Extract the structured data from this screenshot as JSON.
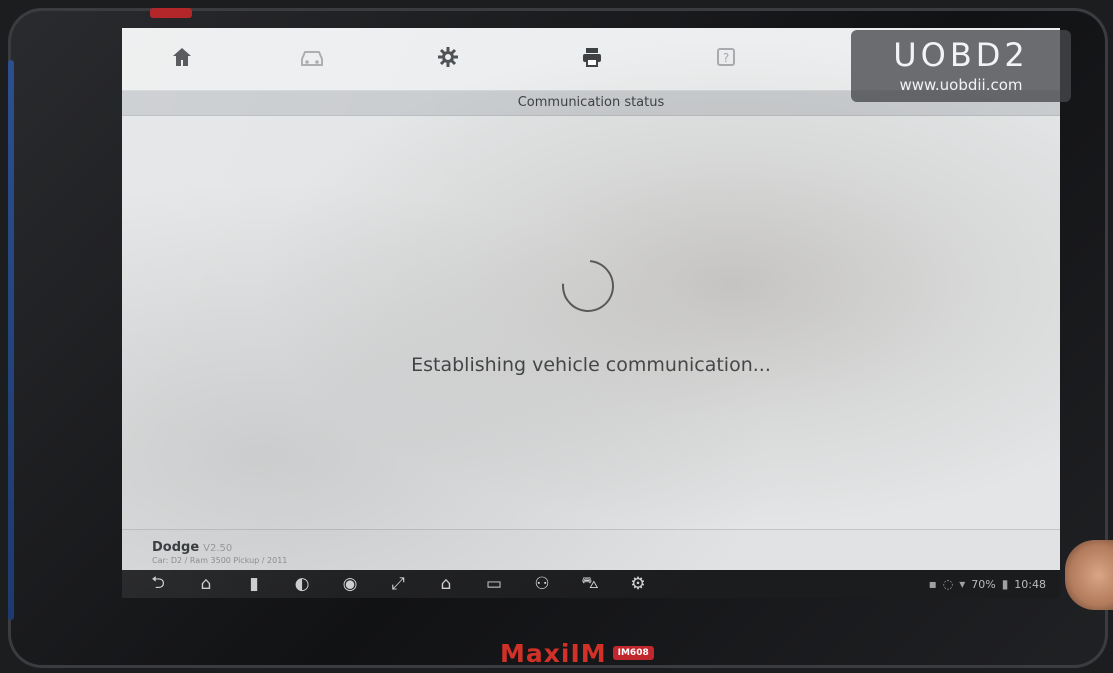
{
  "toolbar": {
    "icons": [
      "home-icon",
      "vehicle-swap-icon",
      "settings-gear-icon",
      "print-icon",
      "help-icon"
    ],
    "title": "Communication status"
  },
  "status": {
    "message": "Establishing vehicle communication..."
  },
  "vehicle": {
    "make": "Dodge",
    "version": "V2.50",
    "details": "Car: D2 / Ram 3500 Pickup / 2011"
  },
  "navbar": {
    "icons": [
      "back-icon",
      "home-icon",
      "recent-apps-icon",
      "chrome-icon",
      "camera-icon",
      "screen-scale-icon",
      "maxiim-home-icon",
      "vci-icon",
      "vehicle-connect-icon",
      "car-icon",
      "service-icon"
    ],
    "battery": "70%",
    "time": "10:48"
  },
  "watermark": {
    "main": "UOBD2",
    "sub": "www.uobdii.com"
  },
  "device": {
    "brand": "MaxiIM",
    "model": "IM608"
  },
  "colors": {
    "screen_bg": "#e3e5e6",
    "title_bar": "#c9cccf",
    "navbar": "#1b1c1e",
    "brand_red": "#d23127"
  }
}
